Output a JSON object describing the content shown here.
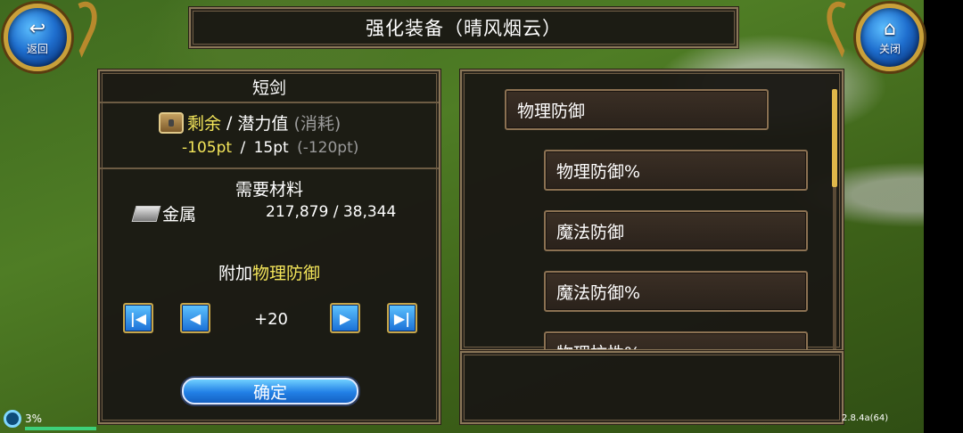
{
  "header": {
    "title": "强化装备（晴风烟云）"
  },
  "nav": {
    "back_label": "返回",
    "close_label": "关闭"
  },
  "left": {
    "item_name": "短剑",
    "points": {
      "remain_label": "剩余",
      "sep": "/",
      "potential_label": "潜力值",
      "consume_label": "(消耗)",
      "remain_value": "-105pt",
      "potential_value": "15pt",
      "consume_value": "(-120pt)"
    },
    "materials_title": "需要材料",
    "material_name": "金属",
    "material_value": "217,879 / 38,344",
    "attach_prefix": "附加",
    "attach_attr": "物理防御",
    "step_value": "+20",
    "confirm_label": "确定"
  },
  "options": [
    {
      "label": "物理防御"
    },
    {
      "label": "物理防御%"
    },
    {
      "label": "魔法防御"
    },
    {
      "label": "魔法防御%"
    },
    {
      "label": "物理抗性%"
    }
  ],
  "status": {
    "battery": "3%",
    "version": "2.8.4a(64)"
  },
  "colors": {
    "highlight": "#f3e55a",
    "frame": "#8a7658",
    "button_blue": "#1a6fd6"
  }
}
